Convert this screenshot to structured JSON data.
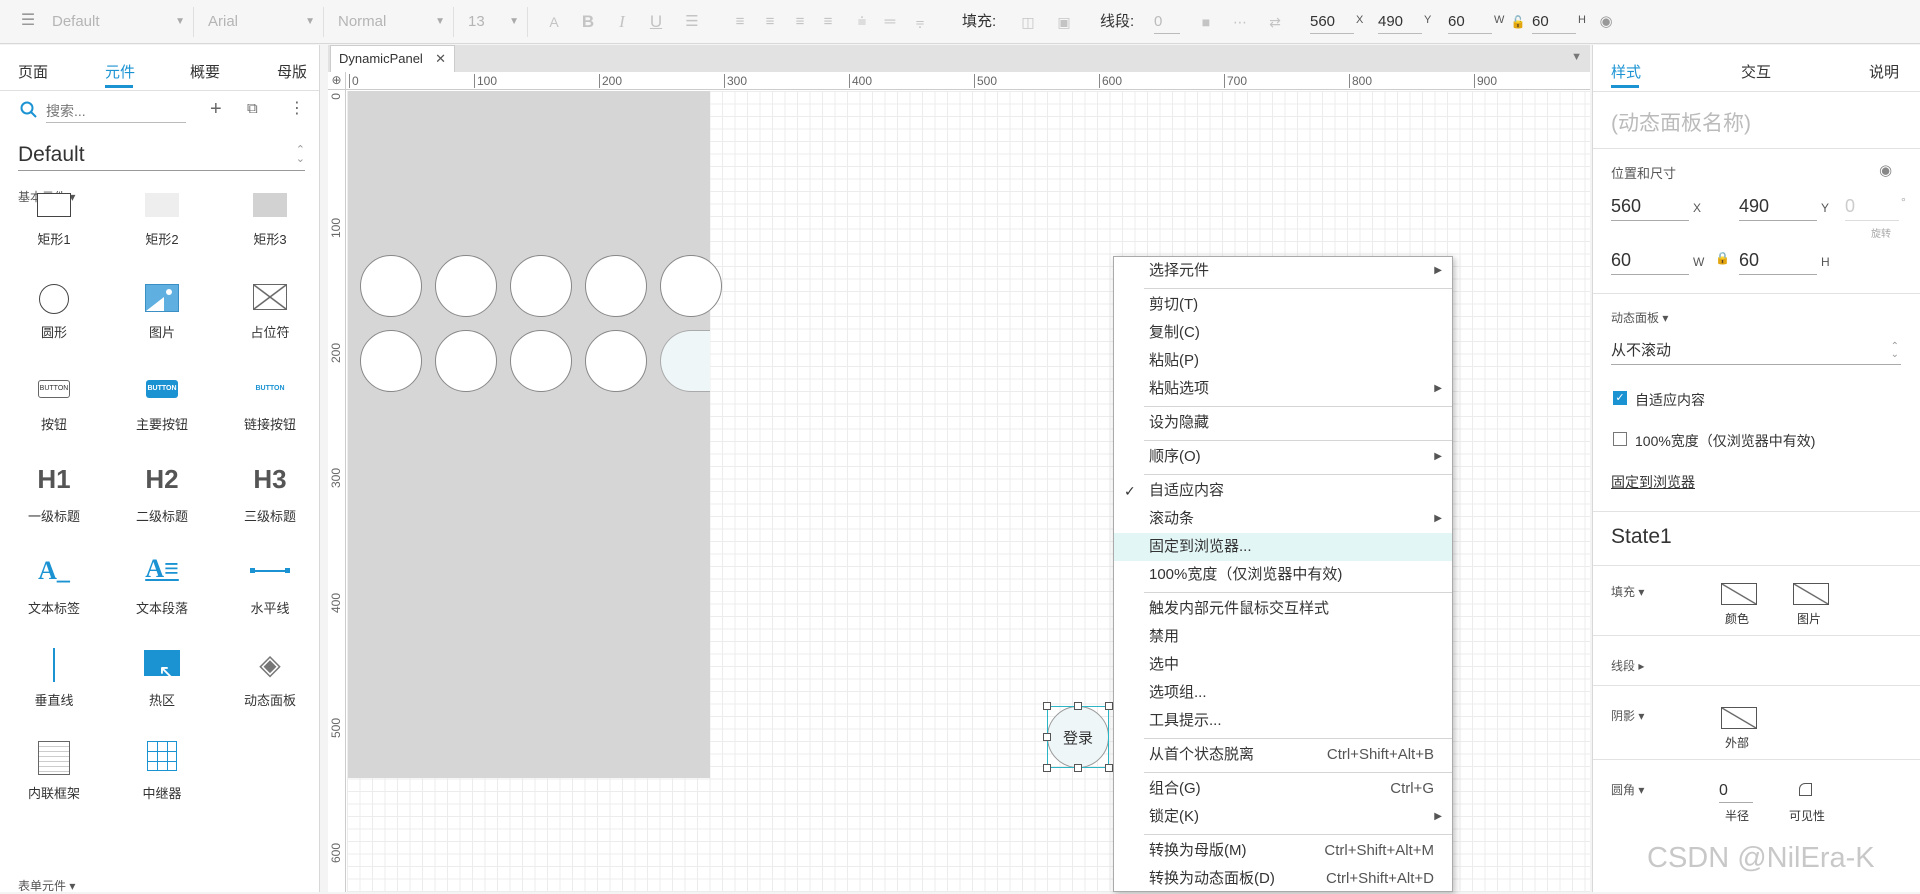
{
  "toolbar": {
    "style_select": "Default",
    "font_select": "Arial",
    "weight_select": "Normal",
    "size_select": "13",
    "fill_label": "填充:",
    "stroke_label": "线段:",
    "stroke_width": "0",
    "x": "560",
    "x_unit": "X",
    "y": "490",
    "y_unit": "Y",
    "w": "60",
    "w_unit": "W",
    "h": "60",
    "h_unit": "H"
  },
  "left": {
    "tabs": [
      "页面",
      "元件",
      "概要",
      "母版"
    ],
    "active_tab": 1,
    "search_placeholder": "搜索...",
    "library": "Default",
    "basic_section": "基本元件 ▾",
    "form_section": "表单元件 ▾",
    "widgets": [
      {
        "label": "矩形1",
        "icon": "rect-outline-icon"
      },
      {
        "label": "矩形2",
        "icon": "rect-light-icon"
      },
      {
        "label": "矩形3",
        "icon": "rect-gray-icon"
      },
      {
        "label": "圆形",
        "icon": "circle-icon"
      },
      {
        "label": "图片",
        "icon": "image-icon"
      },
      {
        "label": "占位符",
        "icon": "placeholder-icon"
      },
      {
        "label": "按钮",
        "icon": "button-icon",
        "icon_text": "BUTTON"
      },
      {
        "label": "主要按钮",
        "icon": "primary-button-icon",
        "icon_text": "BUTTON"
      },
      {
        "label": "链接按钮",
        "icon": "link-button-icon",
        "icon_text": "BUTTON"
      },
      {
        "label": "一级标题",
        "icon": "h1-icon",
        "icon_text": "H1"
      },
      {
        "label": "二级标题",
        "icon": "h2-icon",
        "icon_text": "H2"
      },
      {
        "label": "三级标题",
        "icon": "h3-icon",
        "icon_text": "H3"
      },
      {
        "label": "文本标签",
        "icon": "text-label-icon",
        "icon_text": "A_"
      },
      {
        "label": "文本段落",
        "icon": "text-paragraph-icon",
        "icon_text": "A"
      },
      {
        "label": "水平线",
        "icon": "horizontal-line-icon"
      },
      {
        "label": "垂直线",
        "icon": "vertical-line-icon"
      },
      {
        "label": "热区",
        "icon": "hotspot-icon"
      },
      {
        "label": "动态面板",
        "icon": "dynamic-panel-icon"
      },
      {
        "label": "内联框架",
        "icon": "inline-frame-icon"
      },
      {
        "label": "中继器",
        "icon": "repeater-icon"
      }
    ]
  },
  "canvas": {
    "tab_title": "DynamicPanel",
    "ruler_h": [
      "0",
      "100",
      "200",
      "300",
      "400",
      "500",
      "600",
      "700",
      "800",
      "900"
    ],
    "ruler_v": [
      "0",
      "100",
      "200",
      "300",
      "400",
      "500",
      "600"
    ],
    "selected_widget_label": "登录"
  },
  "context_menu": {
    "items": [
      {
        "label": "选择元件",
        "submenu": true
      },
      {
        "label": "剪切(T)"
      },
      {
        "label": "复制(C)"
      },
      {
        "label": "粘贴(P)"
      },
      {
        "label": "粘贴选项",
        "submenu": true
      },
      {
        "label": "设为隐藏"
      },
      {
        "label": "顺序(O)",
        "submenu": true
      },
      {
        "label": "自适应内容",
        "checked": true
      },
      {
        "label": "滚动条",
        "submenu": true
      },
      {
        "label": "固定到浏览器...",
        "highlighted": true
      },
      {
        "label": "100%宽度（仅浏览器中有效)"
      },
      {
        "label": "触发内部元件鼠标交互样式"
      },
      {
        "label": "禁用"
      },
      {
        "label": "选中"
      },
      {
        "label": "选项组..."
      },
      {
        "label": "工具提示..."
      },
      {
        "label": "从首个状态脱离",
        "shortcut": "Ctrl+Shift+Alt+B"
      },
      {
        "label": "组合(G)",
        "shortcut": "Ctrl+G"
      },
      {
        "label": "锁定(K)",
        "submenu": true
      },
      {
        "label": "转换为母版(M)",
        "shortcut": "Ctrl+Shift+Alt+M"
      },
      {
        "label": "转换为动态面板(D)",
        "shortcut": "Ctrl+Shift+Alt+D"
      }
    ]
  },
  "right": {
    "tabs": [
      "样式",
      "交互",
      "说明"
    ],
    "name_placeholder": "(动态面板名称)",
    "pos_size_label": "位置和尺寸",
    "x": "560",
    "x_unit": "X",
    "y": "490",
    "y_unit": "Y",
    "rotation": "0",
    "rotation_unit": "°",
    "rotation_label": "旋转",
    "w": "60",
    "w_unit": "W",
    "h": "60",
    "h_unit": "H",
    "panel_label": "动态面板 ▾",
    "scroll_value": "从不滚动",
    "fit_content": "自适应内容",
    "full_width": "100%宽度（仅浏览器中有效)",
    "pin_link": "固定到浏览器",
    "state_name": "State1",
    "fill_label": "填充 ▾",
    "fill_color": "颜色",
    "fill_image": "图片",
    "stroke_label": "线段 ▸",
    "shadow_label": "阴影 ▾",
    "shadow_outer": "外部",
    "radius_label": "圆角 ▾",
    "radius_value": "0",
    "radius_unit": "半径",
    "visibility": "可见性"
  },
  "watermark": "CSDN @NilEra-K",
  "colors": {
    "accent": "#1b93d3",
    "panel_gray": "#d6d6d6",
    "selection": "#2bb5c5"
  }
}
